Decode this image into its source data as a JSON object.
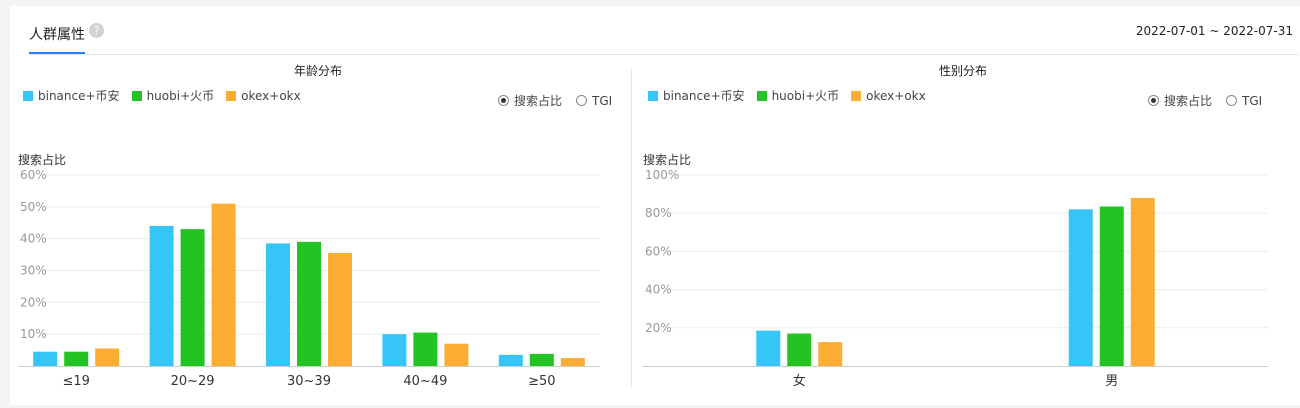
{
  "tab": {
    "label": "人群属性",
    "help_icon": "question-circle-icon"
  },
  "date_range": "2022-07-01 ~ 2022-07-31",
  "colors": {
    "binance": "#36c5f7",
    "huobi": "#22c322",
    "okex": "#fbad34",
    "accent": "#2f7df6"
  },
  "chart_data": [
    {
      "type": "bar",
      "title": "年龄分布",
      "ylabel": "搜索占比",
      "categories": [
        "≤19",
        "20~29",
        "30~39",
        "40~49",
        "≥50"
      ],
      "yticks": [
        "10%",
        "20%",
        "30%",
        "40%",
        "50%",
        "60%"
      ],
      "ylim": [
        0,
        60
      ],
      "series": [
        {
          "name": "binance+币安",
          "values": [
            4.5,
            44,
            38.5,
            10,
            3.5
          ]
        },
        {
          "name": "huobi+火币",
          "values": [
            4.5,
            43,
            39,
            10.5,
            3.8
          ]
        },
        {
          "name": "okex+okx",
          "values": [
            5.5,
            51,
            35.5,
            7,
            2.5
          ]
        }
      ],
      "options": [
        {
          "label": "搜索占比",
          "selected": true
        },
        {
          "label": "TGI",
          "selected": false
        }
      ],
      "legend": "top-left",
      "grid": true
    },
    {
      "type": "bar",
      "title": "性别分布",
      "ylabel": "搜索占比",
      "categories": [
        "女",
        "男"
      ],
      "yticks": [
        "20%",
        "40%",
        "60%",
        "80%",
        "100%"
      ],
      "ylim": [
        0,
        100
      ],
      "series": [
        {
          "name": "binance+币安",
          "values": [
            18.5,
            82
          ]
        },
        {
          "name": "huobi+火币",
          "values": [
            17,
            83.5
          ]
        },
        {
          "name": "okex+okx",
          "values": [
            12.5,
            88
          ]
        }
      ],
      "options": [
        {
          "label": "搜索占比",
          "selected": true
        },
        {
          "label": "TGI",
          "selected": false
        }
      ],
      "legend": "top-left",
      "grid": true
    }
  ]
}
